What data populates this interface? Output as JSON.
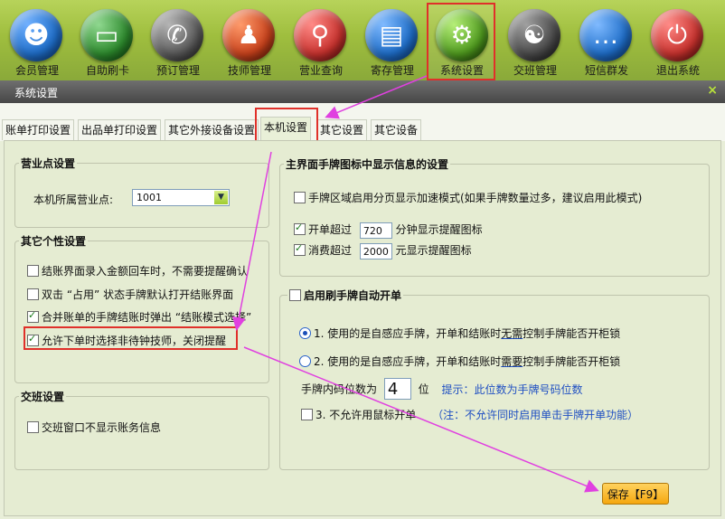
{
  "toolbar": {
    "items": [
      {
        "label": "会员管理",
        "icon": "member-icon",
        "color": "#1f6ec9"
      },
      {
        "label": "自助刷卡",
        "icon": "card-icon",
        "color": "#2d8a2d"
      },
      {
        "label": "预订管理",
        "icon": "phone-icon",
        "color": "#5a5a5a"
      },
      {
        "label": "技师管理",
        "icon": "technician-icon",
        "color": "#c9421c"
      },
      {
        "label": "营业查询",
        "icon": "search-icon",
        "color": "#c8322e"
      },
      {
        "label": "寄存管理",
        "icon": "bag-icon",
        "color": "#1f6ec9"
      },
      {
        "label": "系统设置",
        "icon": "gear-icon",
        "color": "#4f9a1e"
      },
      {
        "label": "交班管理",
        "icon": "shift-icon",
        "color": "#4a4a4a"
      },
      {
        "label": "短信群发",
        "icon": "sms-icon",
        "color": "#1f6ec9"
      },
      {
        "label": "退出系统",
        "icon": "power-icon",
        "color": "#c8322e"
      }
    ]
  },
  "window": {
    "title": "系统设置",
    "close": "×"
  },
  "tabs": [
    "账单打印设置",
    "出品单打印设置",
    "其它外接设备设置",
    "本机设置",
    "其它设置",
    "其它设备"
  ],
  "business_point": {
    "title": "营业点设置",
    "label": "本机所属营业点:",
    "value": "1001"
  },
  "personal": {
    "title": "其它个性设置",
    "items": [
      {
        "text": "结账界面录入金额回车时，不需要提醒确认",
        "checked": false
      },
      {
        "text": "双击 “占用” 状态手牌默认打开结账界面",
        "checked": false
      },
      {
        "text": "合并账单的手牌结账时弹出 “结账模式选择”",
        "checked": true
      },
      {
        "text": "允许下单时选择非待钟技师，关闭提醒",
        "checked": true
      }
    ]
  },
  "shift": {
    "title": "交班设置",
    "item": "交班窗口不显示账务信息"
  },
  "main_icon": {
    "title": "主界面手牌图标中显示信息的设置",
    "paging": "手牌区域启用分页显示加速模式(如果手牌数量过多，建议启用此模式)",
    "open_prefix": "开单超过",
    "open_value": "720",
    "open_suffix": "分钟显示提醒图标",
    "spend_prefix": "消费超过",
    "spend_value": "2000",
    "spend_suffix": "元显示提醒图标"
  },
  "card_open": {
    "title": "启用刷手牌自动开单",
    "opt1_a": "1. 使用的是自感应手牌，开单和结账时",
    "opt1_b": "无需",
    "opt1_c": "控制手牌能否开柜锁",
    "opt2_a": "2. 使用的是自感应手牌，开单和结账时",
    "opt2_b": "需要",
    "opt2_c": "控制手牌能否开柜锁",
    "digits_label": "手牌内码位数为",
    "digits_value": "4",
    "digits_unit": "位",
    "digits_hint": "提示：此位数为手牌号码位数",
    "opt3": "3. 不允许用鼠标开单",
    "opt3_note": "（注：不允许同时启用单击手牌开单功能）"
  },
  "save": "保存【F9】",
  "colors": {
    "highlight": "#e0302a",
    "arrow": "#e040e0",
    "link": "#1f4fc2"
  }
}
